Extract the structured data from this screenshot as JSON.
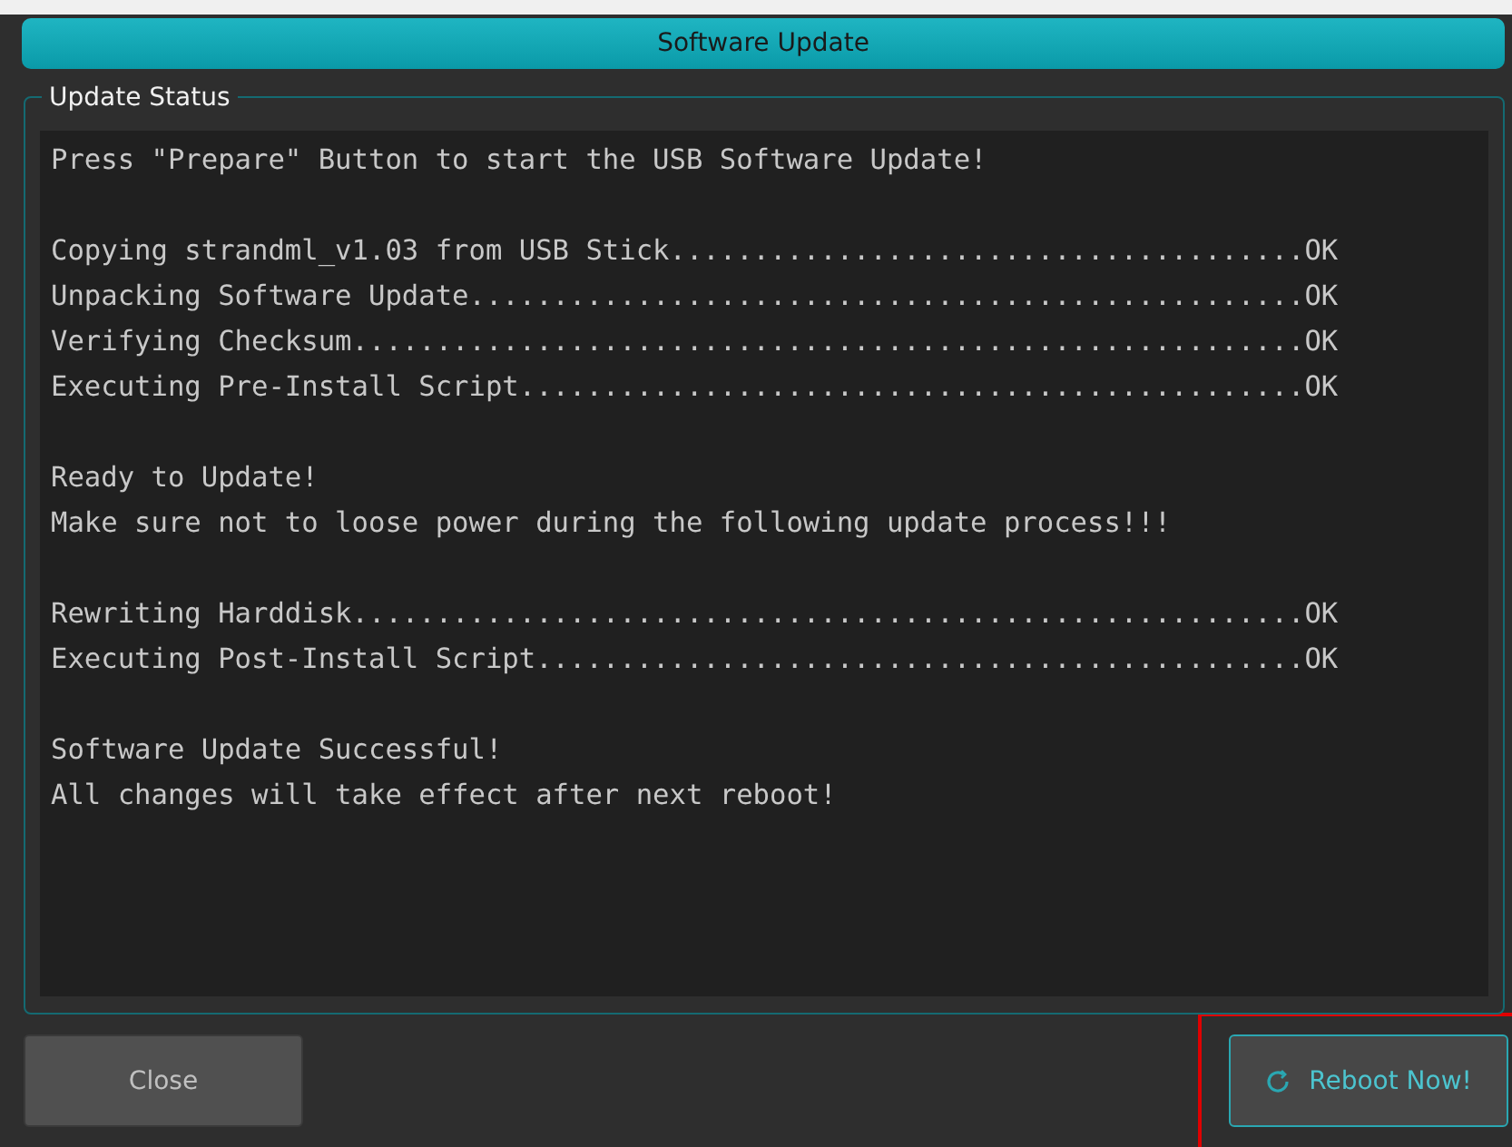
{
  "window": {
    "title": "Software Update"
  },
  "status_group": {
    "title": "Update Status",
    "paragraphs": [
      [
        "Press \"Prepare\" Button to start the USB Software Update!"
      ],
      [
        "Copying strandml_v1.03 from USB Stick......................................OK",
        "Unpacking Software Update..................................................OK",
        "Verifying Checksum.........................................................OK",
        "Executing Pre-Install Script...............................................OK"
      ],
      [
        "Ready to Update!",
        "Make sure not to loose power during the following update process!!!"
      ],
      [
        "Rewriting Harddisk.........................................................OK",
        "Executing Post-Install Script..............................................OK"
      ],
      [
        "Software Update Successful!",
        "All changes will take effect after next reboot!"
      ]
    ]
  },
  "buttons": [
    {
      "kind": "plain",
      "label": "Close",
      "highlighted": false
    },
    {
      "kind": "reboot",
      "label": "Reboot Now!",
      "highlighted": true
    }
  ]
}
